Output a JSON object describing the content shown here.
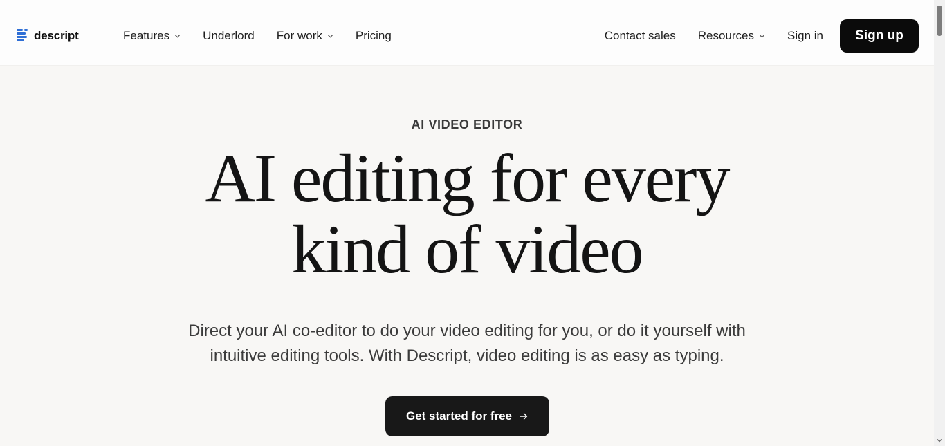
{
  "brand": {
    "name": "descript",
    "logo_icon": "descript-logo-icon",
    "accent": "#2f6fd6"
  },
  "nav": {
    "left": [
      {
        "label": "Features",
        "dropdown": true
      },
      {
        "label": "Underlord",
        "dropdown": false
      },
      {
        "label": "For work",
        "dropdown": true
      },
      {
        "label": "Pricing",
        "dropdown": false
      }
    ],
    "right": [
      {
        "label": "Contact sales",
        "dropdown": false
      },
      {
        "label": "Resources",
        "dropdown": true
      },
      {
        "label": "Sign in",
        "dropdown": false
      }
    ],
    "signup_label": "Sign up"
  },
  "hero": {
    "eyebrow": "AI VIDEO EDITOR",
    "headline_line1": "AI editing for every",
    "headline_line2": "kind of video",
    "subtext_line1": "Direct your AI co-editor to do your video editing for you, or do it yourself with",
    "subtext_line2": "intuitive editing tools. With Descript, video editing is as easy as typing.",
    "cta_label": "Get started for free",
    "cta_icon": "arrow-right-icon"
  },
  "colors": {
    "background": "#f8f7f5",
    "header": "#fdfdfd",
    "button_dark": "#0b0b0b",
    "text": "#1b1b1b"
  }
}
